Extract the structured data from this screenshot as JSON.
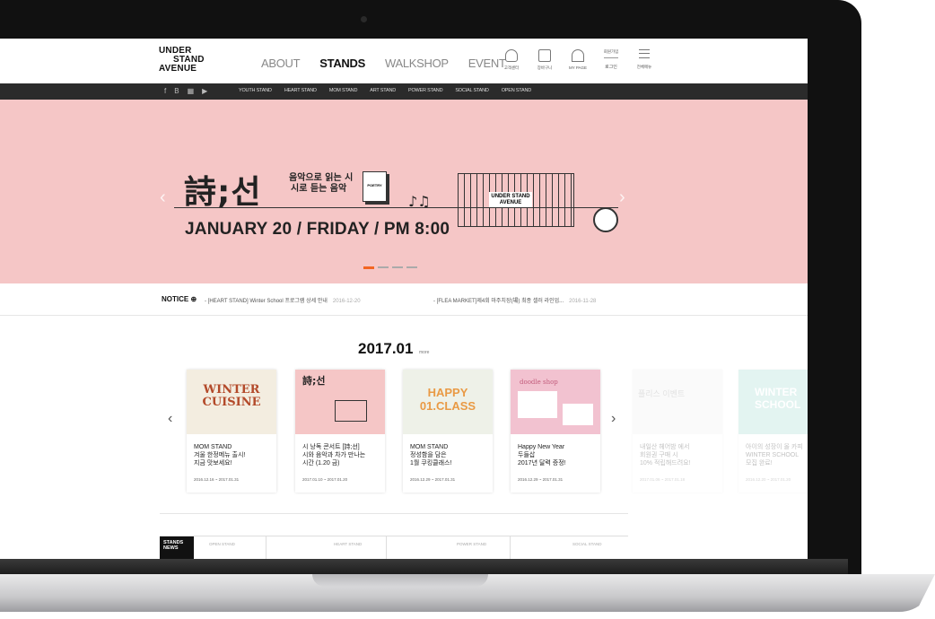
{
  "logo": {
    "line1": "UNDER",
    "line2": "STAND",
    "line3": "AVENUE"
  },
  "nav": [
    "ABOUT",
    "STANDS",
    "WALKSHOP",
    "EVENT"
  ],
  "utility": [
    {
      "label": "고객센터",
      "icon": "headset-icon"
    },
    {
      "label": "장바구니",
      "icon": "bag-icon"
    },
    {
      "label": "MY PAGE",
      "icon": "user-icon"
    },
    {
      "label": "로그인",
      "top": "회원가입",
      "icon": "login-icon"
    },
    {
      "label": "전체메뉴",
      "icon": "menu-icon"
    }
  ],
  "social": [
    "f",
    "B",
    "▦",
    "▶"
  ],
  "subnav": [
    "YOUTH STAND",
    "HEART STAND",
    "MOM STAND",
    "ART STAND",
    "POWER STAND",
    "SOCIAL STAND",
    "OPEN STAND"
  ],
  "hero": {
    "title": "詩;선",
    "subtitle1": "음악으로 읽는 시",
    "subtitle2": "시로 듣는 음악",
    "date": "JANUARY 20 / FRIDAY / PM 8:00",
    "book_label": "POETRY",
    "container_label": "UNDER STAND AVENUE",
    "bg": "#f5c6c6"
  },
  "notice": {
    "label": "NOTICE",
    "items": [
      {
        "text": "[HEART STAND] Winter School 프로그램 상세 안내",
        "date": "2016-12-20"
      },
      {
        "text": "[FLEA MARKET]제4회 마주치장(場) 최종 셀러 라인업...",
        "date": "2016-11-28"
      }
    ]
  },
  "section": {
    "title": "2017.01",
    "more": "more"
  },
  "cards": [
    {
      "cat": "MOM STAND",
      "desc": "겨울 한정메뉴 출시!\n지금 맛보세요!",
      "date": "2016.12.16 ~ 2017.01.31",
      "thumb": "WINTER CUISINE"
    },
    {
      "cat": "시 낭독 콘서트 [詩;선]",
      "desc": "시와 음악과 차가 만나는\n시간 (1.20 금)",
      "date": "2017.01.10 ~ 2017.01.20",
      "thumb": "詩;선"
    },
    {
      "cat": "MOM STAND",
      "desc": "정성함을 담은\n1월 쿠킹클래스!",
      "date": "2016.12.29 ~ 2017.01.31",
      "thumb": "HAPPY 01.CLASS"
    },
    {
      "cat": "Happy New Year",
      "desc": "두들삽\n2017년 달력 증정!",
      "date": "2016.12.29 ~ 2017.01.31",
      "thumb": "doodle shop"
    },
    {
      "cat": "내일산 헤어밤 에서",
      "desc": "회원권 구매 시\n10% 적립해드려요!",
      "date": "2017.01.06 ~ 2017.01.18",
      "thumb": "플리스 이벤트"
    },
    {
      "cat": "아이의 성장이 올 카피",
      "desc": "WINTER SCHOOL\n모집 완료!",
      "date": "2016.12.20 ~ 2017.01.20",
      "thumb": "WINTER SCHOOL"
    }
  ],
  "news": {
    "box": "STANDS NEWS",
    "tabs": [
      "OPEN STAND",
      "HEART STAND",
      "POWER STAND",
      "SOCIAL STAND"
    ]
  }
}
